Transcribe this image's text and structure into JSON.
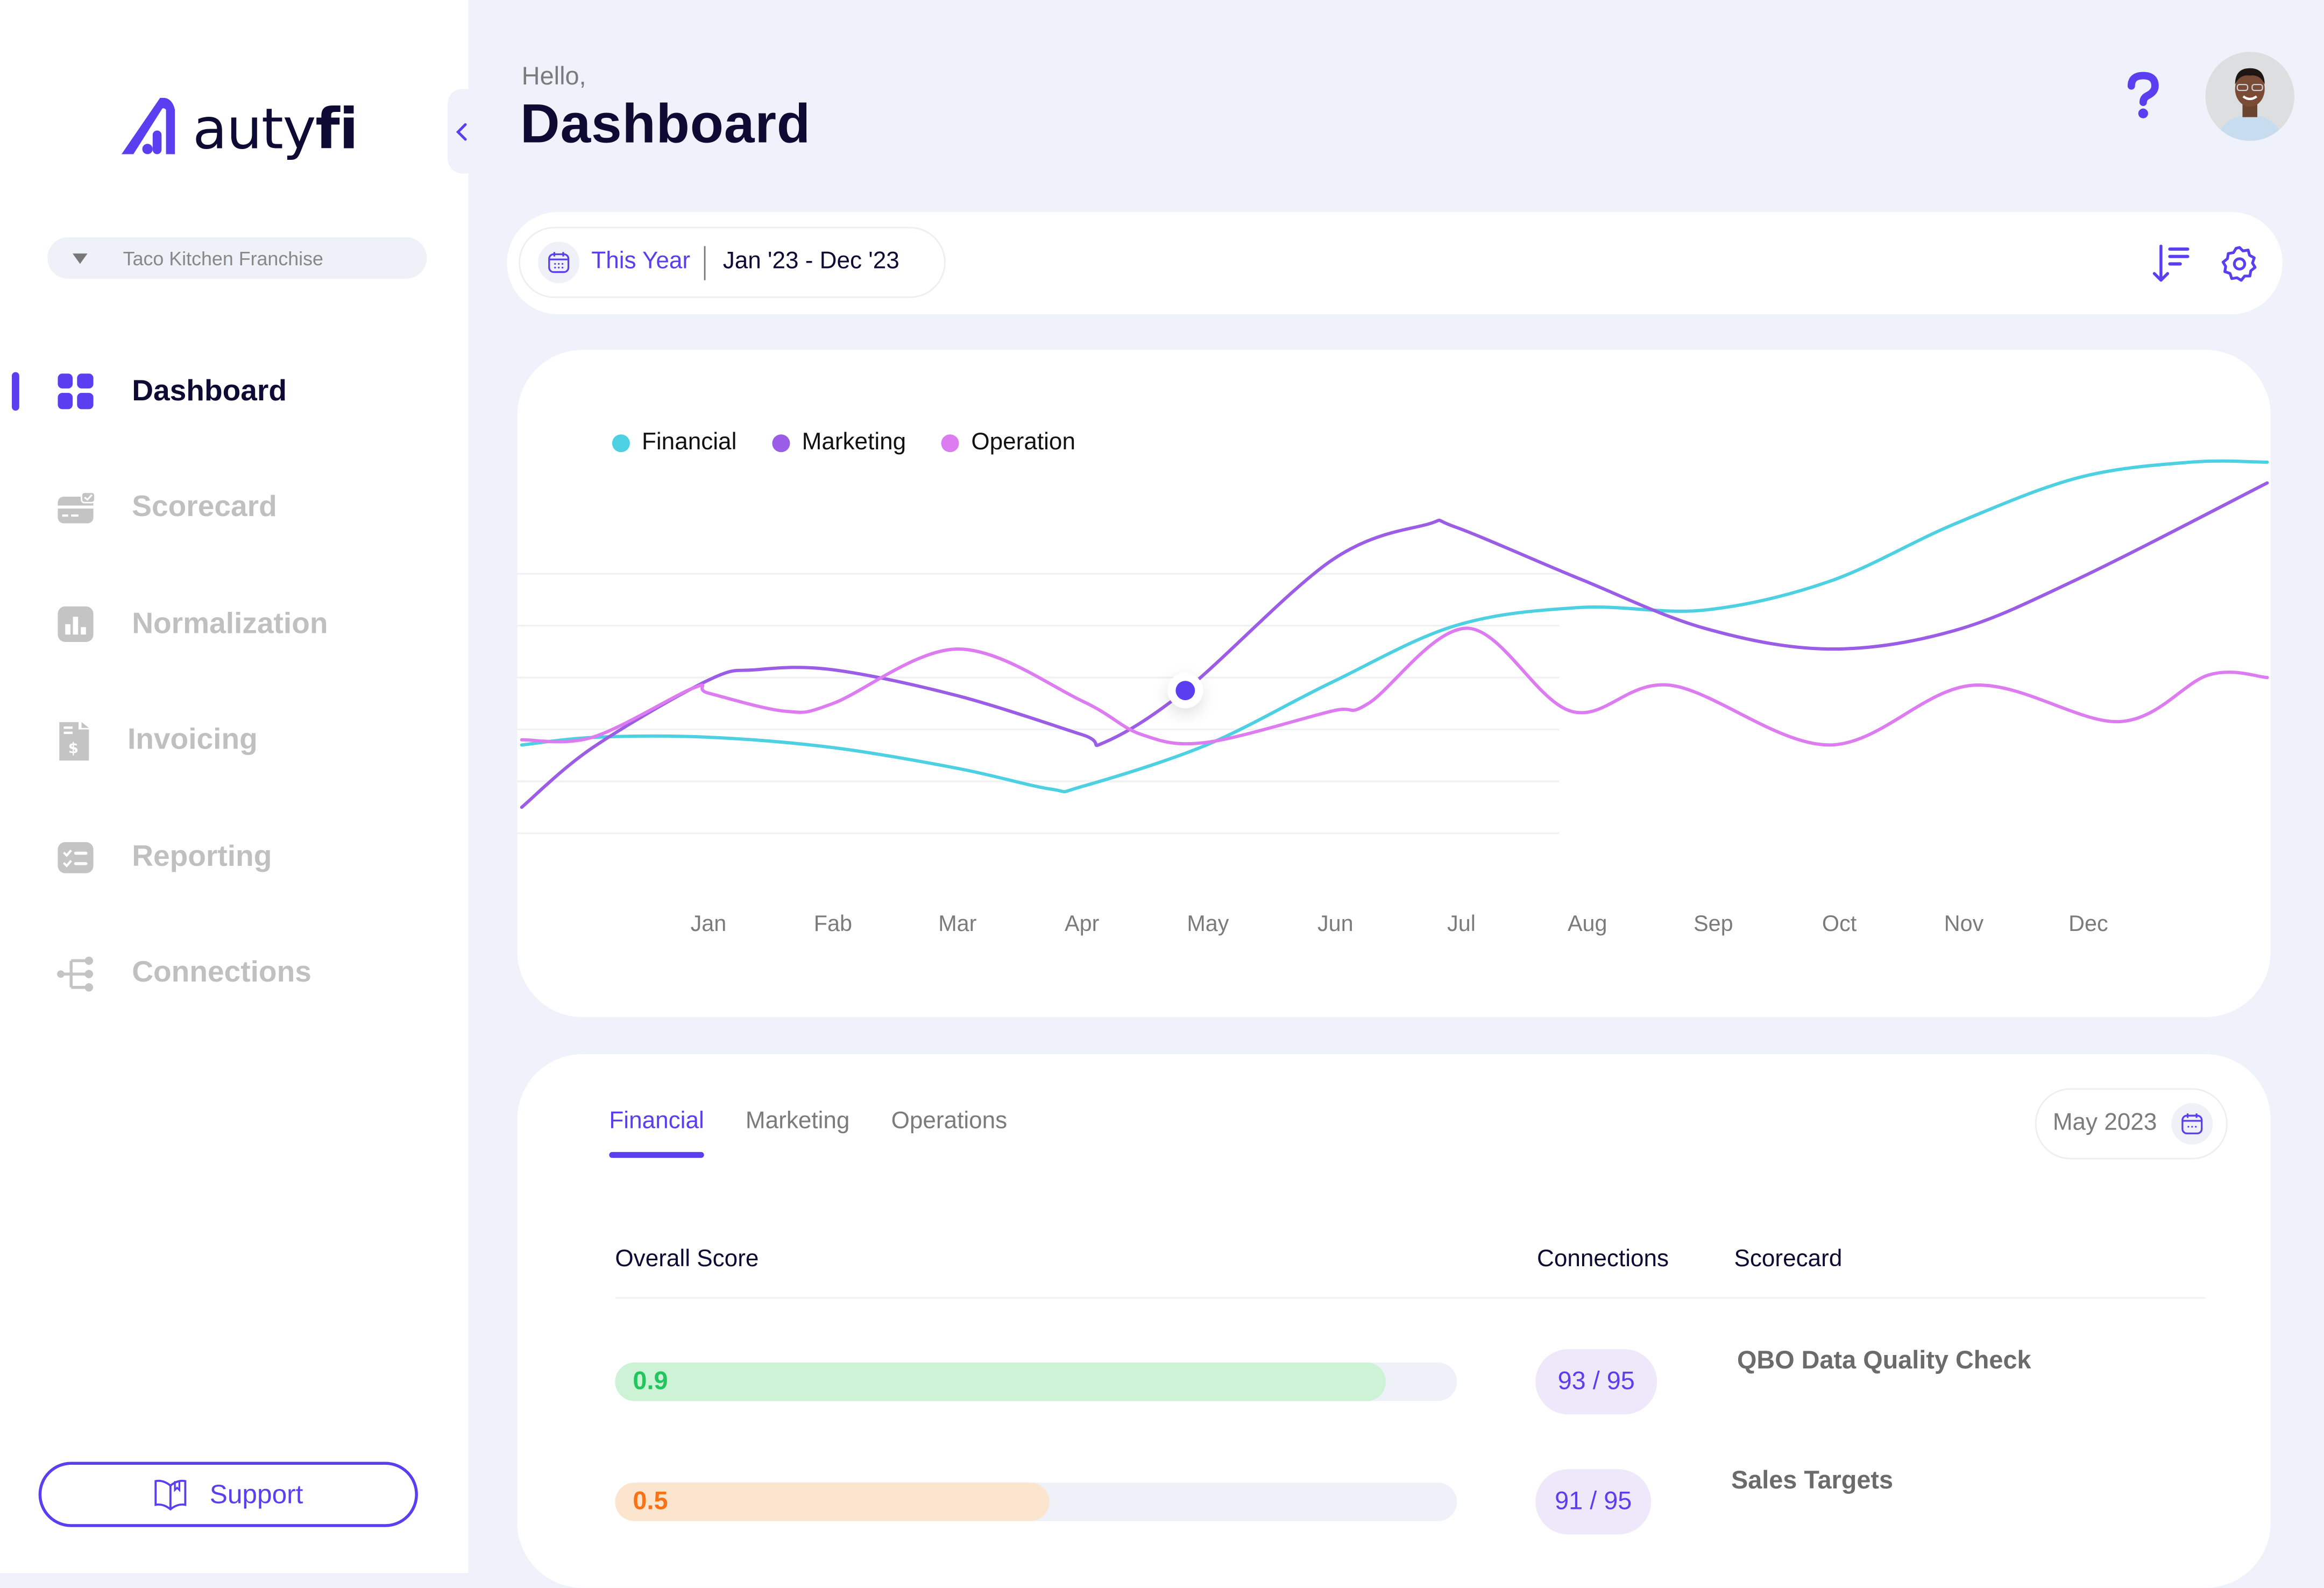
{
  "brand": {
    "name_main": "auty",
    "name_accent": "fi",
    "primary_color": "#5b3ef0",
    "dark_color": "#0d0b33"
  },
  "sidebar": {
    "org_selector": "Taco Kitchen Franchise",
    "items": [
      {
        "label": "Dashboard",
        "icon": "grid-icon",
        "active": true
      },
      {
        "label": "Scorecard",
        "icon": "scorecard-icon",
        "active": false
      },
      {
        "label": "Normalization",
        "icon": "bar-chart-icon",
        "active": false
      },
      {
        "label": "Invoicing",
        "icon": "invoice-icon",
        "active": false
      },
      {
        "label": "Reporting",
        "icon": "checklist-icon",
        "active": false
      },
      {
        "label": "Connections",
        "icon": "connections-icon",
        "active": false
      }
    ],
    "support_label": "Support"
  },
  "header": {
    "greeting": "Hello,",
    "title": "Dashboard"
  },
  "toolbar": {
    "range_label": "This Year",
    "range_value": "Jan '23 - Dec '23"
  },
  "chart_data": {
    "type": "line",
    "title": "",
    "xlabel": "",
    "ylabel": "",
    "categories": [
      "Jan",
      "Fab",
      "Mar",
      "Apr",
      "May",
      "Jun",
      "Jul",
      "Aug",
      "Sep",
      "Oct",
      "Nov",
      "Dec"
    ],
    "ylim": [
      0,
      160
    ],
    "grid_values": [
      0,
      20,
      40,
      60,
      80,
      100
    ],
    "grid": true,
    "legend_position": "top-left",
    "highlight": {
      "series": "Marketing",
      "category": "May",
      "value": 55
    },
    "series": [
      {
        "name": "Financial",
        "color": "#4dd0e1",
        "points": [
          [
            -1.5,
            34
          ],
          [
            -0.9,
            37
          ],
          [
            0,
            37
          ],
          [
            1,
            33
          ],
          [
            2,
            25
          ],
          [
            2.75,
            17
          ],
          [
            3,
            18
          ],
          [
            4,
            34
          ],
          [
            5,
            58
          ],
          [
            6,
            80
          ],
          [
            7,
            87
          ],
          [
            8,
            86
          ],
          [
            9,
            97
          ],
          [
            10,
            119
          ],
          [
            11,
            137
          ],
          [
            11.9,
            143
          ],
          [
            12.52,
            143
          ]
        ]
      },
      {
        "name": "Marketing",
        "color": "#9b5de5",
        "points": [
          [
            -1.5,
            10
          ],
          [
            -0.93,
            33
          ],
          [
            0,
            59
          ],
          [
            0.38,
            63
          ],
          [
            1,
            63
          ],
          [
            2,
            53
          ],
          [
            3,
            38
          ],
          [
            3.18,
            35
          ],
          [
            3.83,
            55
          ],
          [
            5,
            105
          ],
          [
            5.77,
            119
          ],
          [
            6,
            118
          ],
          [
            7,
            98
          ],
          [
            8,
            79
          ],
          [
            9,
            71
          ],
          [
            10,
            78
          ],
          [
            11,
            98
          ],
          [
            12.52,
            135
          ]
        ]
      },
      {
        "name": "Operation",
        "color": "#dd7bf0",
        "points": [
          [
            -1.5,
            36
          ],
          [
            -0.93,
            37
          ],
          [
            -0.12,
            56
          ],
          [
            0,
            54
          ],
          [
            0.62,
            47
          ],
          [
            1,
            50
          ],
          [
            2,
            71
          ],
          [
            3,
            51
          ],
          [
            3.48,
            38
          ],
          [
            4,
            35
          ],
          [
            5,
            47
          ],
          [
            5.3,
            50
          ],
          [
            6.1,
            79
          ],
          [
            6.93,
            47
          ],
          [
            7.73,
            57
          ],
          [
            9,
            34
          ],
          [
            10.15,
            57
          ],
          [
            11.33,
            43
          ],
          [
            12.05,
            61
          ],
          [
            12.52,
            60
          ]
        ]
      }
    ]
  },
  "scores": {
    "tabs": [
      {
        "label": "Financial",
        "active": true
      },
      {
        "label": "Marketing",
        "active": false
      },
      {
        "label": "Operations",
        "active": false
      }
    ],
    "month": "May 2023",
    "columns": {
      "overall": "Overall Score",
      "connections": "Connections",
      "scorecard": "Scorecard"
    },
    "rows": [
      {
        "score": "0.9",
        "score_fraction": 0.9,
        "fill_color": "#ccf3d6",
        "text_color": "#22c55e",
        "connections": "93 / 95",
        "scorecard": "QBO Data Quality Check"
      },
      {
        "score": "0.5",
        "score_fraction": 0.5,
        "fill_color": "#fbe5cf",
        "text_color": "#f97316",
        "connections": "91 / 95",
        "scorecard": "Sales Targets"
      }
    ]
  }
}
